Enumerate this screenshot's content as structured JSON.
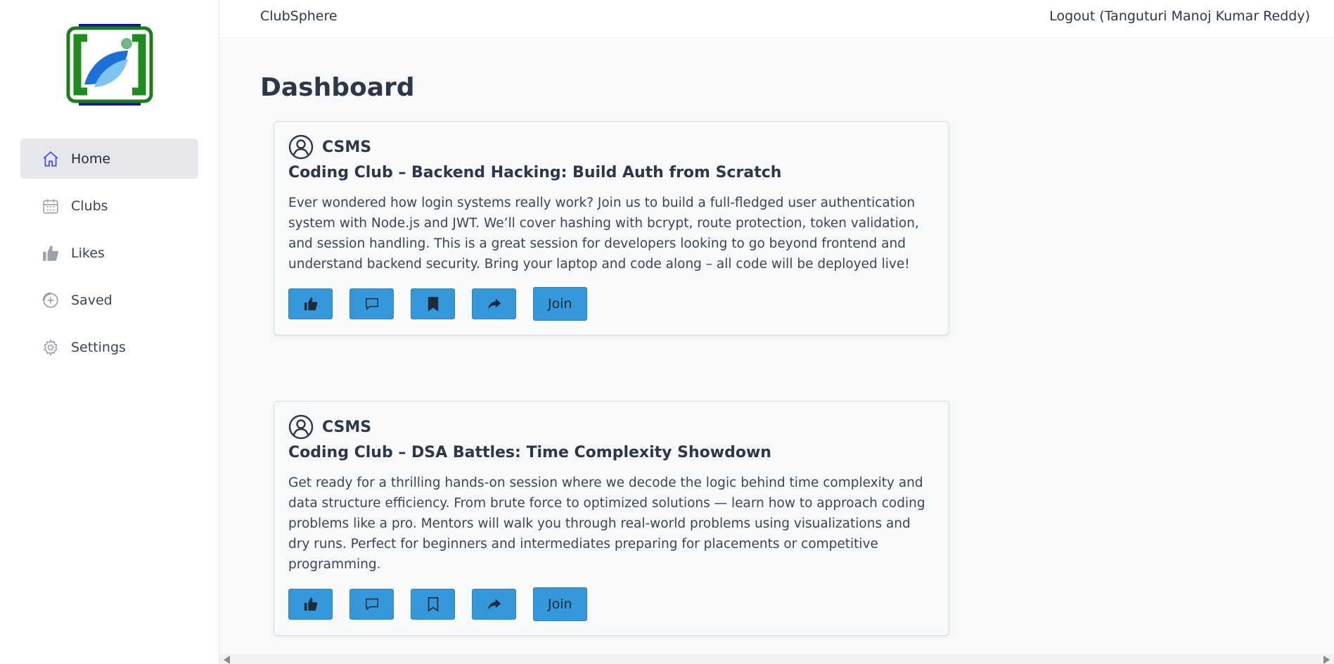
{
  "app": {
    "brand": "ClubSphere",
    "logout_label": "Logout (Tanguturi Manoj Kumar Reddy)"
  },
  "sidebar": {
    "items": [
      {
        "label": "Home",
        "icon": "home-icon",
        "active": true
      },
      {
        "label": "Clubs",
        "icon": "calendar-icon",
        "active": false
      },
      {
        "label": "Likes",
        "icon": "thumbs-up-icon",
        "active": false
      },
      {
        "label": "Saved",
        "icon": "saved-icon",
        "active": false
      },
      {
        "label": "Settings",
        "icon": "gear-icon",
        "active": false
      }
    ]
  },
  "main": {
    "title": "Dashboard",
    "posts": [
      {
        "club": "CSMS",
        "title": "Coding Club – Backend Hacking: Build Auth from Scratch",
        "description": "Ever wondered how login systems really work? Join us to build a full-fledged user authentication system with Node.js and JWT. We’ll cover hashing with bcrypt, route protection, token validation, and session handling. This is a great session for developers looking to go beyond frontend and understand backend security. Bring your laptop and code along – all code will be deployed live!",
        "saved": true,
        "join_label": "Join"
      },
      {
        "club": "CSMS",
        "title": "Coding Club – DSA Battles: Time Complexity Showdown",
        "description": "Get ready for a thrilling hands-on session where we decode the logic behind time complexity and data structure efficiency. From brute force to optimized solutions — learn how to approach coding problems like a pro. Mentors will walk you through real-world problems using visualizations and dry runs. Perfect for beginners and intermediates preparing for placements or competitive programming.",
        "saved": false,
        "join_label": "Join"
      }
    ]
  },
  "colors": {
    "accent": "#3498db",
    "text": "#2d3748",
    "active_nav": "#e5e7eb",
    "background": "#f8f9fa"
  }
}
